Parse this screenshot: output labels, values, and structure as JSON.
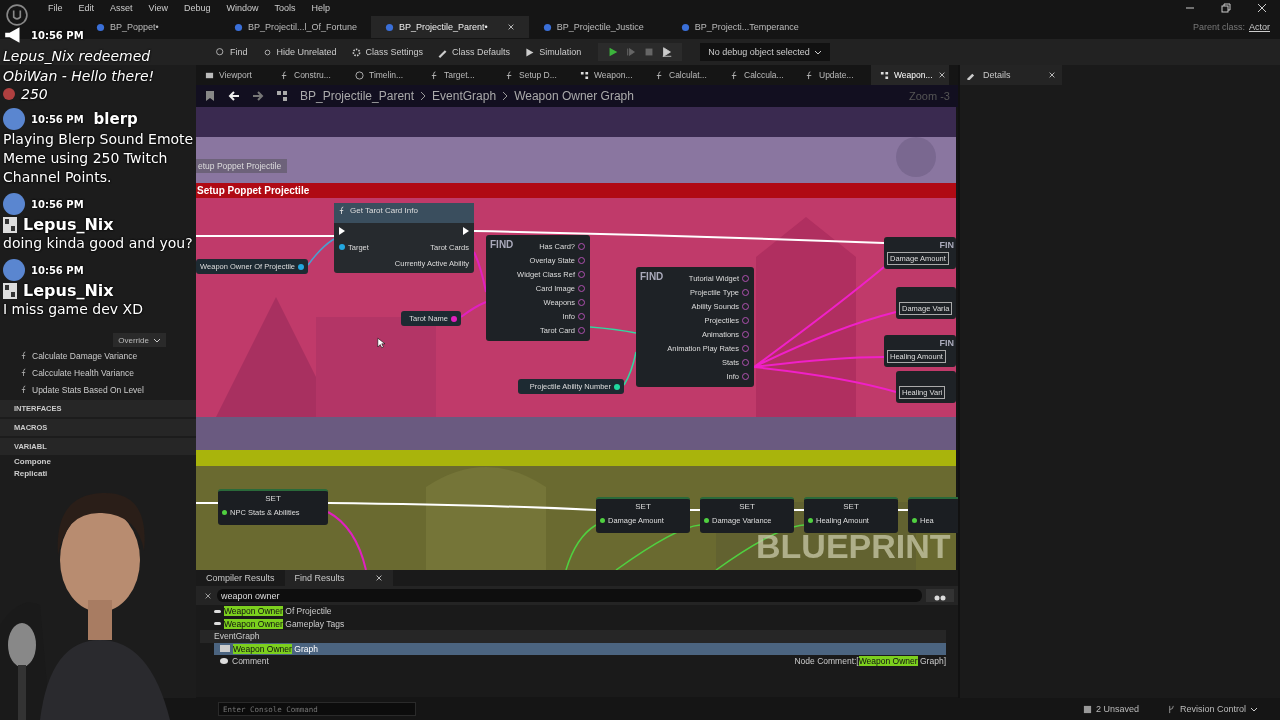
{
  "menu": [
    "File",
    "Edit",
    "Asset",
    "View",
    "Debug",
    "Window",
    "Tools",
    "Help"
  ],
  "doc_tabs": [
    {
      "label": "BP_Poppet•",
      "selected": false
    },
    {
      "label": "BP_Projectil...l_Of_Fortune",
      "selected": false
    },
    {
      "label": "BP_Projectile_Parent•",
      "selected": true
    },
    {
      "label": "BP_Projectile_Justice",
      "selected": false
    },
    {
      "label": "BP_Projecti...Temperance",
      "selected": false
    }
  ],
  "parent_class": {
    "label": "Parent class:",
    "value": "Actor"
  },
  "toolbar": [
    {
      "label": "Find",
      "kind": "find"
    },
    {
      "label": "Hide Unrelated",
      "kind": "hide"
    },
    {
      "label": "Class Settings",
      "kind": "settings"
    },
    {
      "label": "Class Defaults",
      "kind": "defaults"
    },
    {
      "label": "Simulation",
      "kind": "sim"
    }
  ],
  "debug_select": "No debug object selected",
  "editor_tabs": [
    {
      "label": "Viewport",
      "kind": "viewport",
      "selected": false
    },
    {
      "label": "Constru...",
      "kind": "function",
      "selected": false
    },
    {
      "label": "Timelin...",
      "kind": "timeline",
      "selected": false
    },
    {
      "label": "Target...",
      "kind": "function",
      "selected": false
    },
    {
      "label": "Setup D...",
      "kind": "function",
      "selected": false
    },
    {
      "label": "Weapon...",
      "kind": "graph",
      "selected": false
    },
    {
      "label": "Calculat...",
      "kind": "function",
      "selected": false
    },
    {
      "label": "Calccula...",
      "kind": "function",
      "selected": false
    },
    {
      "label": "Update...",
      "kind": "function",
      "selected": false
    },
    {
      "label": "Weapon...",
      "kind": "graph",
      "selected": true
    }
  ],
  "details_tab": "Details",
  "my_blueprint": {
    "override": "Override",
    "items": [
      {
        "label": "Calculate Damage Variance",
        "kind": "function"
      },
      {
        "label": "Calcculate Health Variance",
        "kind": "function"
      },
      {
        "label": "Update Stats Based On Level",
        "kind": "function"
      },
      {
        "label": "INTERFACES",
        "kind": "section"
      },
      {
        "label": "MACROS",
        "kind": "section"
      },
      {
        "label": "VARIABL",
        "kind": "section"
      },
      {
        "label": "Compone",
        "kind": "category"
      },
      {
        "label": "Replicati",
        "kind": "category"
      }
    ]
  },
  "breadcrumb": [
    "BP_Projectile_Parent",
    "EventGraph",
    "Weapon Owner Graph"
  ],
  "zoom": "Zoom -3",
  "graph": {
    "comment_bubble": "etup Poppet Projectile",
    "comments": [
      {
        "title": "Setup Poppet Projectile",
        "color": "#b00a14"
      },
      {
        "color": "#a9b40c"
      }
    ],
    "nodes": [
      {
        "kind": "var",
        "title": "Weapon Owner Of Projectile",
        "color": "#22a7e0"
      },
      {
        "kind": "func",
        "title": "Get Tarot Card Info",
        "inputs": [
          "Target"
        ],
        "outputs": [
          "Tarot Cards",
          "Currently Active Ability"
        ]
      },
      {
        "kind": "break",
        "overlay": "FIND",
        "outputs": [
          "Has Card?",
          "Overlay State",
          "Widget Class Ref",
          "Card Image",
          "Weapons",
          "Info",
          "Tarot Card"
        ]
      },
      {
        "kind": "var",
        "title": "Tarot Name",
        "color": "#e020c0"
      },
      {
        "kind": "break",
        "overlay": "FIND",
        "outputs": [
          "Tutorial Widget",
          "Projectile Type",
          "Ability Sounds",
          "Projectiles",
          "Animations",
          "Animation Play Rates",
          "Stats",
          "Info"
        ]
      },
      {
        "kind": "var",
        "title": "Projectile Ability Number",
        "color": "#20d8a0"
      },
      {
        "kind": "find",
        "title": "Damage Amount",
        "overlay": "FIN"
      },
      {
        "kind": "find",
        "title": "Damage Varia"
      },
      {
        "kind": "find",
        "title": "Healing Amount",
        "overlay": "FIN"
      },
      {
        "kind": "find",
        "title": "Healing Vari"
      },
      {
        "kind": "set",
        "title": "SET",
        "pin_label": "NPC Stats & Abilities"
      },
      {
        "kind": "set",
        "title": "SET",
        "pin_label": "Damage Amount"
      },
      {
        "kind": "set",
        "title": "SET",
        "pin_label": "Damage Variance"
      },
      {
        "kind": "set",
        "title": "SET",
        "pin_label": "Healing Amount"
      },
      {
        "kind": "set",
        "pin_label": "Hea"
      }
    ],
    "watermark": "BLUEPRINT"
  },
  "bottom_tabs": [
    {
      "label": "Compiler Results",
      "selected": false
    },
    {
      "label": "Find Results",
      "selected": true
    }
  ],
  "find": {
    "query": "weapon owner",
    "results": [
      {
        "kind": "variable",
        "match": "Weapon Owner",
        "text": " Of Projectile",
        "selected": false
      },
      {
        "kind": "variable",
        "match": "Weapon Owner",
        "text": " Gameplay Tags",
        "selected": false
      },
      {
        "kind": "header",
        "text": "EventGraph",
        "selected": false
      },
      {
        "kind": "graph",
        "match": "Weapon Owner",
        "text": " Graph",
        "selected": true
      },
      {
        "kind": "comment",
        "text": "Comment",
        "selected": false,
        "note": "Node Comment:[",
        "note_match": "Weapon Owner",
        "note_end": " Graph]"
      }
    ]
  },
  "console_placeholder": "Enter Console Command",
  "status": {
    "unsaved": "2 Unsaved",
    "revision": "Revision Control"
  },
  "chat": [
    {
      "kind": "redeem",
      "time": "10:56 PM",
      "text": "Lepus_Nix redeemed ObiWan - Hello there!",
      "amount": "250"
    },
    {
      "kind": "message",
      "time": "10:56 PM",
      "user": "blerp",
      "text": "Playing Blerp Sound Emote Meme using 250 Twitch Channel Points."
    },
    {
      "kind": "message",
      "time": "10:56 PM",
      "user": "Lepus_Nix",
      "text": "doing kinda good and you?"
    },
    {
      "kind": "message",
      "time": "10:56 PM",
      "user": "Lepus_Nix",
      "text": "I miss game dev XD"
    }
  ]
}
